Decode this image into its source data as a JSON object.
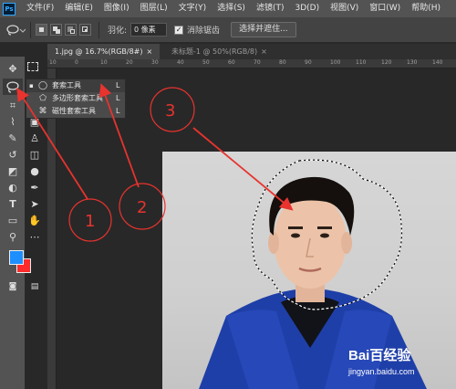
{
  "app": {
    "logo": "Ps"
  },
  "menu": [
    "文件(F)",
    "编辑(E)",
    "图像(I)",
    "图层(L)",
    "文字(Y)",
    "选择(S)",
    "滤镜(T)",
    "3D(D)",
    "视图(V)",
    "窗口(W)",
    "帮助(H)"
  ],
  "options": {
    "feather_label": "羽化:",
    "feather_value": "0 像素",
    "antialias_checked": "✓",
    "antialias_label": "消除锯齿",
    "select_mask_label": "选择并遮住..."
  },
  "tabs": [
    {
      "label": "1.jpg @ 16.7%(RGB/8#)",
      "close": "×"
    },
    {
      "label": "未标题-1 @ 50%(RGB/8)",
      "close": "×"
    }
  ],
  "ruler_labels": [
    "10",
    "0",
    "10",
    "20",
    "30",
    "40",
    "50",
    "60",
    "70",
    "80",
    "90",
    "100",
    "110",
    "120",
    "130",
    "140"
  ],
  "flyout": [
    {
      "bullet": "▪",
      "label": "套索工具",
      "key": "L",
      "icon": "lasso-icon"
    },
    {
      "bullet": "",
      "label": "多边形套索工具",
      "key": "L",
      "icon": "polygonal-lasso-icon"
    },
    {
      "bullet": "",
      "label": "磁性套索工具",
      "key": "L",
      "icon": "magnetic-lasso-icon"
    }
  ],
  "callouts": {
    "one": "1",
    "two": "2",
    "three": "3"
  },
  "watermark": {
    "brand": "Bai百经验",
    "url": "jingyan.baidu.com"
  },
  "colors": {
    "foreground": "#1e8fff",
    "background": "#ff2a2a",
    "annotation": "#e8332e"
  }
}
